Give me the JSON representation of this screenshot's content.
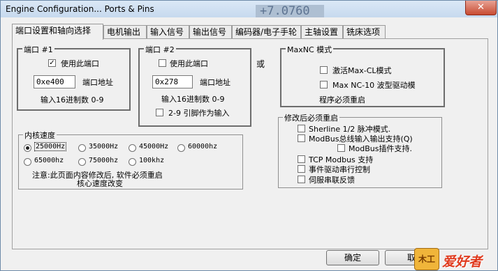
{
  "window": {
    "title": "Engine Configuration... Ports & Pins",
    "close_label": "✕",
    "behind_text": "+7.0760"
  },
  "tabs": [
    {
      "label": "端口设置和轴向选择"
    },
    {
      "label": "电机输出"
    },
    {
      "label": "输入信号"
    },
    {
      "label": "输出信号"
    },
    {
      "label": "编码器/电子手轮"
    },
    {
      "label": "主轴设置"
    },
    {
      "label": "铣床选项"
    }
  ],
  "port1": {
    "legend": "端口 #1",
    "enable_label": "使用此端口",
    "enable_checked": true,
    "address_value": "0xe400",
    "address_label": "端口地址",
    "hint": "输入16进制数 0-9"
  },
  "port2": {
    "legend": "端口 #2",
    "enable_label": "使用此端口",
    "enable_checked": false,
    "address_value": "0x278",
    "address_label": "端口地址",
    "hint": "输入16进制数 0-9",
    "pins_label": "2-9 引脚作为输入",
    "pins_checked": false
  },
  "or_label": "或",
  "maxnc": {
    "legend": "MaxNC 模式",
    "items": [
      {
        "label": "激活Max-CL模式",
        "checked": false
      },
      {
        "label": "Max NC-10 波型驱动模",
        "checked": false
      }
    ],
    "note": "程序必须重启"
  },
  "restart": {
    "legend": "修改后必须重启",
    "items": [
      {
        "label": "Sherline 1/2 脉冲模式.",
        "checked": false
      },
      {
        "label": "ModBus总线输入输出支持(Q)",
        "checked": false
      },
      {
        "label": "ModBus插件支持.",
        "checked": false
      },
      {
        "label": "TCP Modbus 支持",
        "checked": false
      },
      {
        "label": "事件驱动串行控制",
        "checked": false
      },
      {
        "label": "伺服串联反馈",
        "checked": false
      }
    ]
  },
  "kernel": {
    "legend": "内核速度",
    "options": [
      {
        "label": "25000Hz",
        "selected": true
      },
      {
        "label": "35000Hz",
        "selected": false
      },
      {
        "label": "45000Hz",
        "selected": false
      },
      {
        "label": "60000hz",
        "selected": false
      },
      {
        "label": "65000hz",
        "selected": false
      },
      {
        "label": "75000hz",
        "selected": false
      },
      {
        "label": "100khz",
        "selected": false
      }
    ],
    "note_line1": "注意:此页面内容修改后, 软件必须重启",
    "note_line2": "核心速度改变"
  },
  "buttons": {
    "ok": "确定",
    "cancel": "取"
  },
  "watermark": {
    "text": "爱好者",
    "badge": "木工"
  }
}
